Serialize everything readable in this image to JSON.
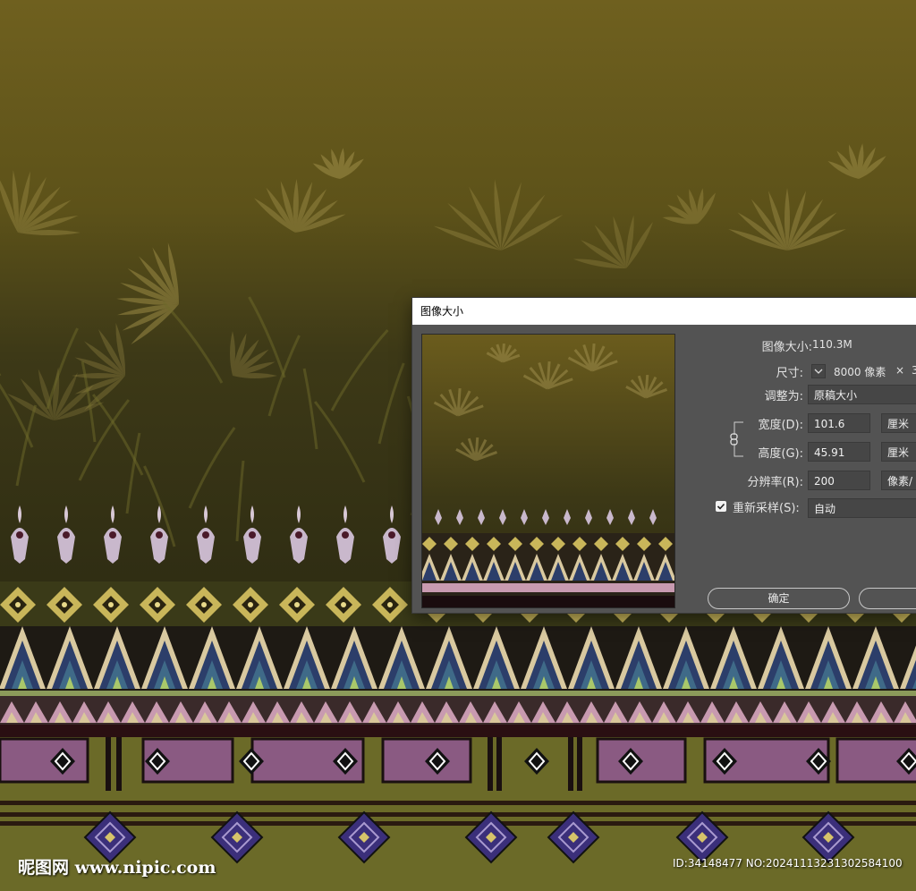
{
  "dialog": {
    "title": "图像大小",
    "image_size_label": "图像大小:",
    "image_size_value": "110.3M",
    "dimensions_label": "尺寸:",
    "dimensions_value": "8000 像素",
    "dimensions_times": "×",
    "dimensions_cut": "3",
    "fit_to_label": "调整为:",
    "fit_to_value": "原稿大小",
    "width_label": "宽度(D):",
    "width_value": "101.6",
    "width_unit": "厘米",
    "height_label": "高度(G):",
    "height_value": "45.91",
    "height_unit": "厘米",
    "resolution_label": "分辨率(R):",
    "resolution_value": "200",
    "resolution_unit": "像素/",
    "resample_label": "重新采样(S):",
    "resample_checked": true,
    "resample_value": "自动",
    "ok_label": "确定",
    "cancel_label": ""
  },
  "watermark": {
    "logo_text": "昵图网 www.nipic.com",
    "id_text": "ID:34148477 NO:20241113231302584100"
  },
  "colors": {
    "background_top": "#6e5f1e",
    "background_mid": "#3f3a16",
    "dialog_bg": "#535353",
    "leaf": "#9a8a45",
    "band_cream": "#d9c9a0",
    "band_navy": "#2c3e6a",
    "band_pink": "#c89ab0",
    "band_purple": "#8a5a82",
    "diamond_purple": "#3b2f7a"
  }
}
